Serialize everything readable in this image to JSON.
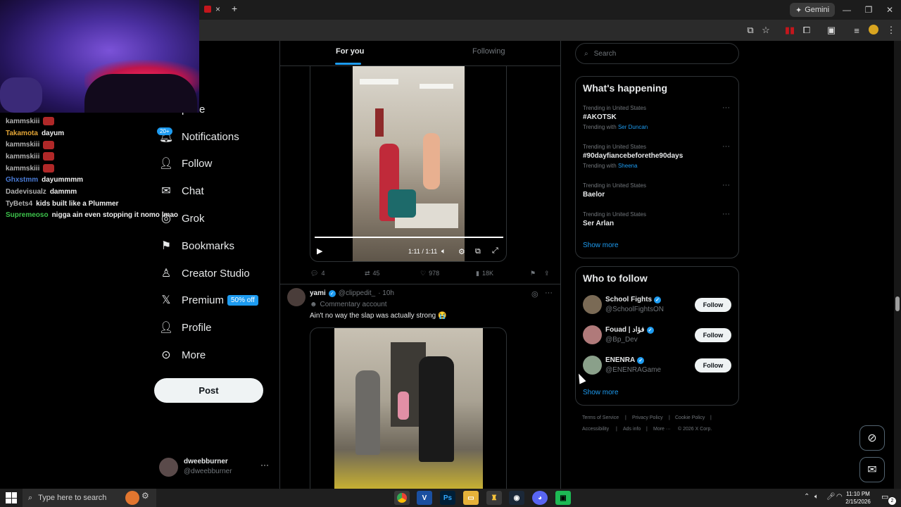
{
  "browser": {
    "gemini_label": "Gemini",
    "tab_close": "×",
    "new_tab": "+"
  },
  "chat": [
    {
      "user": "kammskiii",
      "color": "#b0b0b0",
      "msg": "",
      "emote": true
    },
    {
      "user": "Takamota",
      "color": "#e3a536",
      "msg": "dayum",
      "emote": false
    },
    {
      "user": "kammskiii",
      "color": "#b0b0b0",
      "msg": "",
      "emote": true
    },
    {
      "user": "kammskiii",
      "color": "#b0b0b0",
      "msg": "",
      "emote": true
    },
    {
      "user": "kammskiii",
      "color": "#b0b0b0",
      "msg": "",
      "emote": true
    },
    {
      "user": "Ghxstmm",
      "color": "#4a7bd6",
      "msg": "dayummmm",
      "emote": false
    },
    {
      "user": "Dadevisualz",
      "color": "#b0b0b0",
      "msg": "dammm",
      "emote": false
    },
    {
      "user": "TyBets4",
      "color": "#b0b0b0",
      "msg": "kids built like a Plummer",
      "emote": false
    },
    {
      "user": "Supremeoso",
      "color": "#3cc24a",
      "msg": "nigga ain even stopping it nomo lmao",
      "emote": false
    }
  ],
  "nav": {
    "home": "me",
    "explore": "plore",
    "notifications": "Notifications",
    "notif_badge": "20+",
    "follow": "Follow",
    "chat": "Chat",
    "grok": "Grok",
    "bookmarks": "Bookmarks",
    "creator_studio": "Creator Studio",
    "premium": "Premium",
    "premium_badge": "50% off",
    "profile": "Profile",
    "more": "More",
    "post": "Post"
  },
  "account": {
    "name": "dweebburner",
    "handle": "@dweebburner"
  },
  "feed": {
    "tabs": [
      "For you",
      "Following"
    ],
    "video1": {
      "time": "1:11 / 1:11"
    },
    "tweet1_stats": {
      "replies": "4",
      "reposts": "45",
      "likes": "978",
      "views": "18K"
    },
    "tweet2": {
      "name": "yami",
      "handle": "@clippedit_",
      "time": "· 10h",
      "label": "Commentary account",
      "text": "Ain't no way the slap was actually strong 😭"
    }
  },
  "search": {
    "placeholder": "Search"
  },
  "trends": {
    "title": "What's happening",
    "items": [
      {
        "meta": "Trending in United States",
        "name": "#AKOTSK",
        "with_label": "Trending with",
        "with": "Ser Duncan"
      },
      {
        "meta": "Trending in United States",
        "name": "#90dayfiancebeforethe90days",
        "with_label": "Trending with",
        "with": "Sheena"
      },
      {
        "meta": "Trending in United States",
        "name": "Baelor",
        "with_label": "",
        "with": ""
      },
      {
        "meta": "Trending in United States",
        "name": "Ser Arlan",
        "with_label": "",
        "with": ""
      }
    ],
    "show_more": "Show more"
  },
  "who_to_follow": {
    "title": "Who to follow",
    "items": [
      {
        "name": "School Fights",
        "handle": "@SchoolFightsON",
        "button": "Follow",
        "avatar_color": "#7a6a55"
      },
      {
        "name": "Fouad | فؤاد",
        "handle": "@Bp_Dev",
        "button": "Follow",
        "avatar_color": "#b07a7a"
      },
      {
        "name": "ENENRA",
        "handle": "@ENENRAGame",
        "button": "Follow",
        "avatar_color": "#8aa08a"
      }
    ],
    "show_more": "Show more"
  },
  "footer": {
    "terms": "Terms of Service",
    "privacy": "Privacy Policy",
    "cookie": "Cookie Policy",
    "accessibility": "Accessibility",
    "ads": "Ads info",
    "more": "More ···",
    "copyright": "© 2026 X Corp."
  },
  "taskbar": {
    "search_placeholder": "Type here to search",
    "time": "11:10 PM",
    "date": "2/15/2026",
    "notif_count": "2"
  },
  "colors": {
    "accent": "#1d9bf0",
    "bg": "#000000",
    "border": "#2f3336",
    "muted": "#71767b"
  }
}
